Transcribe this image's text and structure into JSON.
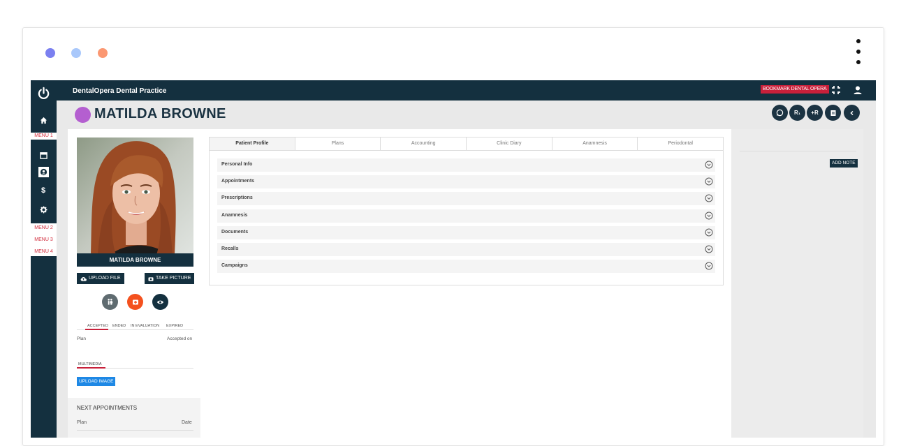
{
  "window": {
    "dots": [
      "#7b80f0",
      "#a9c8fb",
      "#fb9872"
    ]
  },
  "topbar": {
    "brand": "DentalOpera Dental Practice",
    "bookmark_label": "BOOKMARK DENTAL OPERA",
    "icons": [
      "compress-icon",
      "user-icon"
    ]
  },
  "sidebar": {
    "menu1": "MENU 1",
    "menu2": "MENU 2",
    "menu3": "MENU 3",
    "menu4": "MENU 4",
    "icons": [
      "power-icon",
      "home-icon",
      "calendar-icon",
      "patient-icon",
      "dollar-icon",
      "gear-icon"
    ]
  },
  "patient": {
    "name": "MATILDA BROWNE",
    "avatar_color": "#b45fd0",
    "header_actions": [
      "whatsapp-icon",
      "prescription-icon",
      "add-prescription-icon",
      "document-icon",
      "back-icon"
    ],
    "header_action_labels": {
      "rx": "R₁",
      "add_rx": "+R"
    }
  },
  "left": {
    "photo_caption": "MATILDA BROWNE",
    "upload_file": "UPLOAD FILE",
    "take_picture": "TAKE PICTURE",
    "status_tabs": [
      "ACCEPTED",
      "ENDED",
      "IN EVALUATION",
      "EXPIRED"
    ],
    "plan_header": "Plan",
    "accepted_on_header": "Accepted on",
    "multimedia_label": "MULTIMEDIA",
    "upload_image": "UPLOAD IMAGE",
    "next_appointments": {
      "title": "NEXT APPOINTMENTS",
      "plan_header": "Plan",
      "date_header": "Date"
    }
  },
  "tabs": [
    "Patient Profile",
    "Plans",
    "Accounting",
    "Clinic Diary",
    "Anamnesis",
    "Periodontal"
  ],
  "sections": [
    "Personal Info",
    "Appointments",
    "Prescriptions",
    "Anamnesis",
    "Documents",
    "Recalls",
    "Campaigns"
  ],
  "right": {
    "add_note": "ADD NOTE"
  }
}
